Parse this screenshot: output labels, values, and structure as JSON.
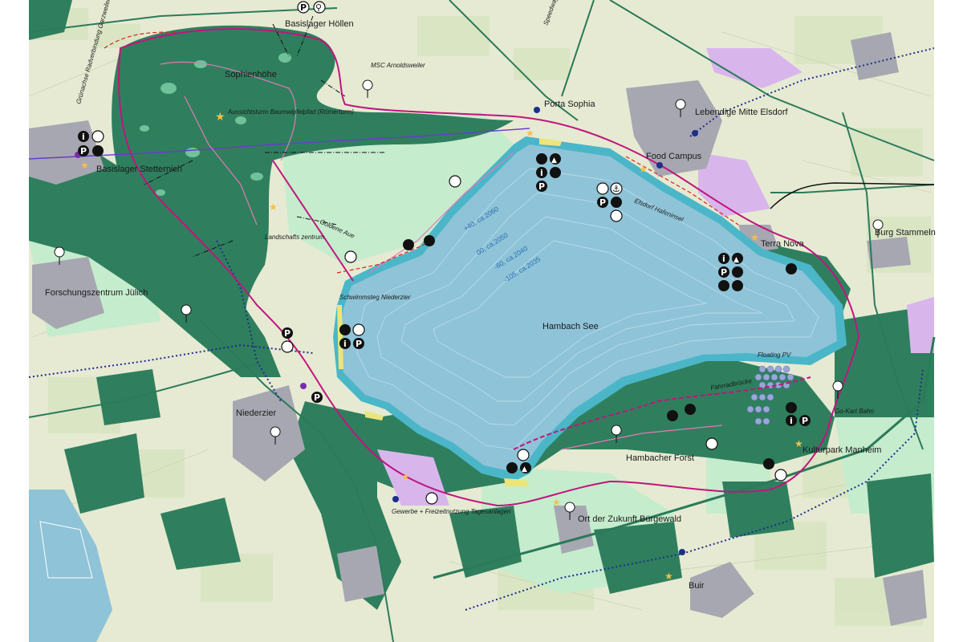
{
  "colors": {
    "farmland": "#e6ead2",
    "farmland_alt": "#d8e4c2",
    "forest": "#2f7f5e",
    "forest_light": "#6fc29a",
    "meadow": "#c5eccd",
    "lake": "#8ec3d8",
    "lake_edge": "#4bb6c8",
    "settlement": "#9a9aa6",
    "purple_zone": "#d8b6ec",
    "magenta_route": "#c0157e",
    "rail_blue": "#1d2f8a",
    "road_green": "#2b7a5a",
    "beach": "#ece57a",
    "highlight": "#f3c04a"
  },
  "labels": {
    "basislager_hoellen": "Basislager Höllen",
    "sophienhoehe": "Sophienhöhe",
    "aussichtsturm": "Aussichtsturm Baumwipfelpfad (Römerturm)",
    "msc": "MSC Arnoldsweiler",
    "porta_sophia": "Porta Sophia",
    "lebendige_mitte": "Lebendige Mitte Elsdorf",
    "food_campus": "Food Campus",
    "elsdorf_hafeninsel": "Elsdorf Hafeninsel",
    "terra_nova": "Terra Nova",
    "burg_stammeln": "Burg Stammeln",
    "basislager_stetternich": "Basislager Stetternich",
    "landschaftszentrum": "Landschafts zentrum",
    "goldene_aue": "Goldene Aue",
    "gruenachse": "Grünachse Radverbindung Garzweiler",
    "forschungszentrum": "Forschungszentrum Jülich",
    "schwimmsteg": "Schwimmsteg Niederzier",
    "hambach_see": "Hambach See",
    "floating_pv": "Floating PV",
    "fahrradbruecke": "Fahrradbrücke",
    "go_kart": "Go-Kart Bahn",
    "kulturpark": "Kulturpark Manheim",
    "hambacher_forst": "Hambacher Forst",
    "niederzier": "Niederzier",
    "gewerbe": "Gewerbe + Freizeitnutzung Tagesanlagen",
    "ort_der_zukunft": "Ort der Zukunft Bürgewald",
    "buir": "Buir",
    "speedway": "Speedway"
  },
  "depth_labels": {
    "d1": "+40, ca.2060",
    "d2": "00, ca.2050",
    "d3": "-60, ca.2040",
    "d4": "-105, ca.2035"
  },
  "icons": {
    "parking": "P",
    "info": "i"
  }
}
